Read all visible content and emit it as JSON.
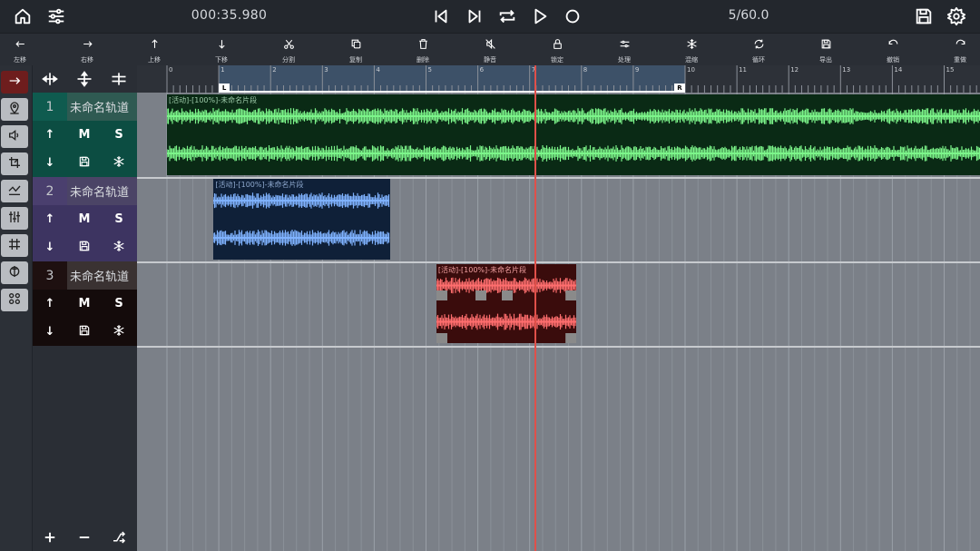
{
  "topbar": {
    "time": "000:35.980",
    "bar_position": "5/60.0",
    "icons": [
      "home-icon",
      "mixer-settings-icon",
      "skip-back-icon",
      "skip-forward-icon",
      "loop-icon",
      "play-icon",
      "record-icon",
      "save-icon",
      "gear-icon"
    ]
  },
  "toolbar": {
    "tools": [
      {
        "id": "move-left",
        "label": "左移",
        "icon": "arrow-left-icon"
      },
      {
        "id": "move-right",
        "label": "右移",
        "icon": "arrow-right-icon"
      },
      {
        "id": "move-up",
        "label": "上移",
        "icon": "arrow-up-icon"
      },
      {
        "id": "move-down",
        "label": "下移",
        "icon": "arrow-down-icon"
      },
      {
        "id": "split",
        "label": "分割",
        "icon": "scissors-icon"
      },
      {
        "id": "copy",
        "label": "复制",
        "icon": "copy-icon"
      },
      {
        "id": "delete",
        "label": "删除",
        "icon": "trash-icon"
      },
      {
        "id": "mute",
        "label": "静音",
        "icon": "mute-icon"
      },
      {
        "id": "lock",
        "label": "锁定",
        "icon": "lock-icon"
      },
      {
        "id": "process",
        "label": "处理",
        "icon": "process-icon"
      },
      {
        "id": "freeze",
        "label": "混缩",
        "icon": "snowflake-icon"
      },
      {
        "id": "loop",
        "label": "循环",
        "icon": "loop-icon"
      },
      {
        "id": "export",
        "label": "导出",
        "icon": "save-icon"
      },
      {
        "id": "undo",
        "label": "撤销",
        "icon": "undo-icon"
      },
      {
        "id": "redo",
        "label": "重做",
        "icon": "redo-icon"
      }
    ]
  },
  "left_tools": [
    "arrow-right-icon",
    "location-icon",
    "volume-icon",
    "crop-icon",
    "envelope-icon",
    "equalizer-icon",
    "grid-icon",
    "plugin-icon",
    "effects-icon"
  ],
  "tracks": [
    {
      "number": "1",
      "name": "未命名轨道",
      "up": "↑",
      "mute": "M",
      "solo": "S",
      "down": "↓",
      "color": "#0f5b4f"
    },
    {
      "number": "2",
      "name": "未命名轨道",
      "up": "↑",
      "mute": "M",
      "solo": "S",
      "down": "↓",
      "color": "#4a3f6e"
    },
    {
      "number": "3",
      "name": "未命名轨道",
      "up": "↑",
      "mute": "M",
      "solo": "S",
      "down": "↓",
      "color": "#1e1010"
    }
  ],
  "ruler": {
    "numbers": [
      "0",
      "1",
      "2",
      "3",
      "4",
      "5",
      "6",
      "7",
      "8",
      "9",
      "10",
      "11",
      "12",
      "13",
      "14",
      "15"
    ],
    "loop_start_marker": "L",
    "loop_end_marker": "R",
    "loop_start": 1,
    "loop_end": 10,
    "playhead": 7.1
  },
  "clips": [
    {
      "track": 0,
      "label": "[活动]-[100%]-未命名片段",
      "start": 0,
      "end": 16,
      "color": "#7cf58a",
      "bg": "#0a2a15"
    },
    {
      "track": 1,
      "label": "[活动]-[100%]-未命名片段",
      "start": 0.9,
      "end": 4.3,
      "color": "#7fb2ff",
      "bg": "#0f2038"
    },
    {
      "track": 2,
      "label": "[活动]-[100%]-未命名片段",
      "start": 5.2,
      "end": 7.9,
      "color": "#ff6e6e",
      "bg": "#3a0c0c"
    }
  ]
}
